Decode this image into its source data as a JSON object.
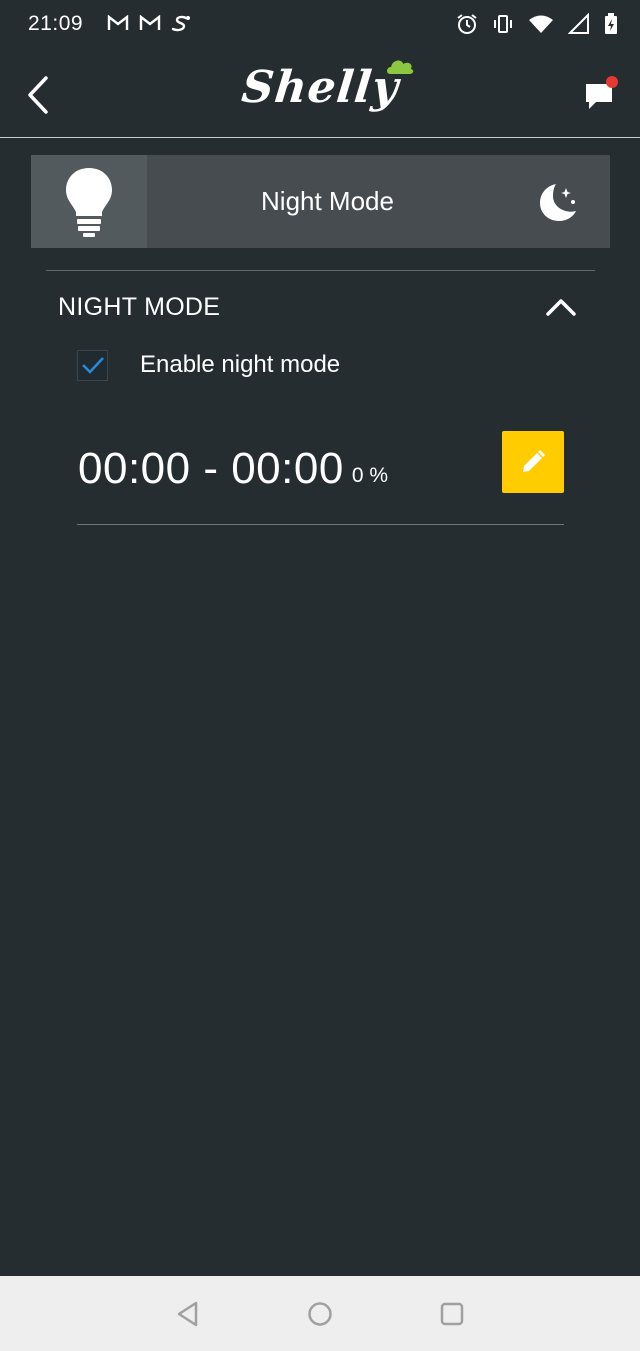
{
  "status_bar": {
    "time": "21:09",
    "icons_left": [
      "gmail-icon",
      "gmail-icon",
      "shelly-notification-icon"
    ],
    "icons_right": [
      "alarm-icon",
      "vibrate-icon",
      "wifi-icon",
      "cell-signal-icon",
      "battery-charging-icon"
    ]
  },
  "app_bar": {
    "logo_text": "Shelly",
    "back_icon": "chevron-left-icon",
    "chat_icon": "chat-bubble-icon",
    "has_notification_dot": true
  },
  "device_tile": {
    "title": "Night Mode",
    "left_icon": "lightbulb-icon",
    "right_icon": "moon-stars-icon"
  },
  "night_mode_section": {
    "title": "NIGHT MODE",
    "expanded": true,
    "enable_checkbox": {
      "label": "Enable night mode",
      "checked": true
    },
    "schedule": {
      "time_range": "00:00 - 00:00",
      "brightness": "0 %"
    }
  },
  "colors": {
    "background": "#262d31",
    "tile": "#464c50",
    "accent_yellow": "#ffcc00",
    "logo_cloud": "#8dc63f",
    "notification_dot": "#e53935",
    "check_blue": "#2a8ad8"
  },
  "nav_bar": {
    "items": [
      "back-triangle-icon",
      "home-circle-icon",
      "recents-square-icon"
    ]
  }
}
